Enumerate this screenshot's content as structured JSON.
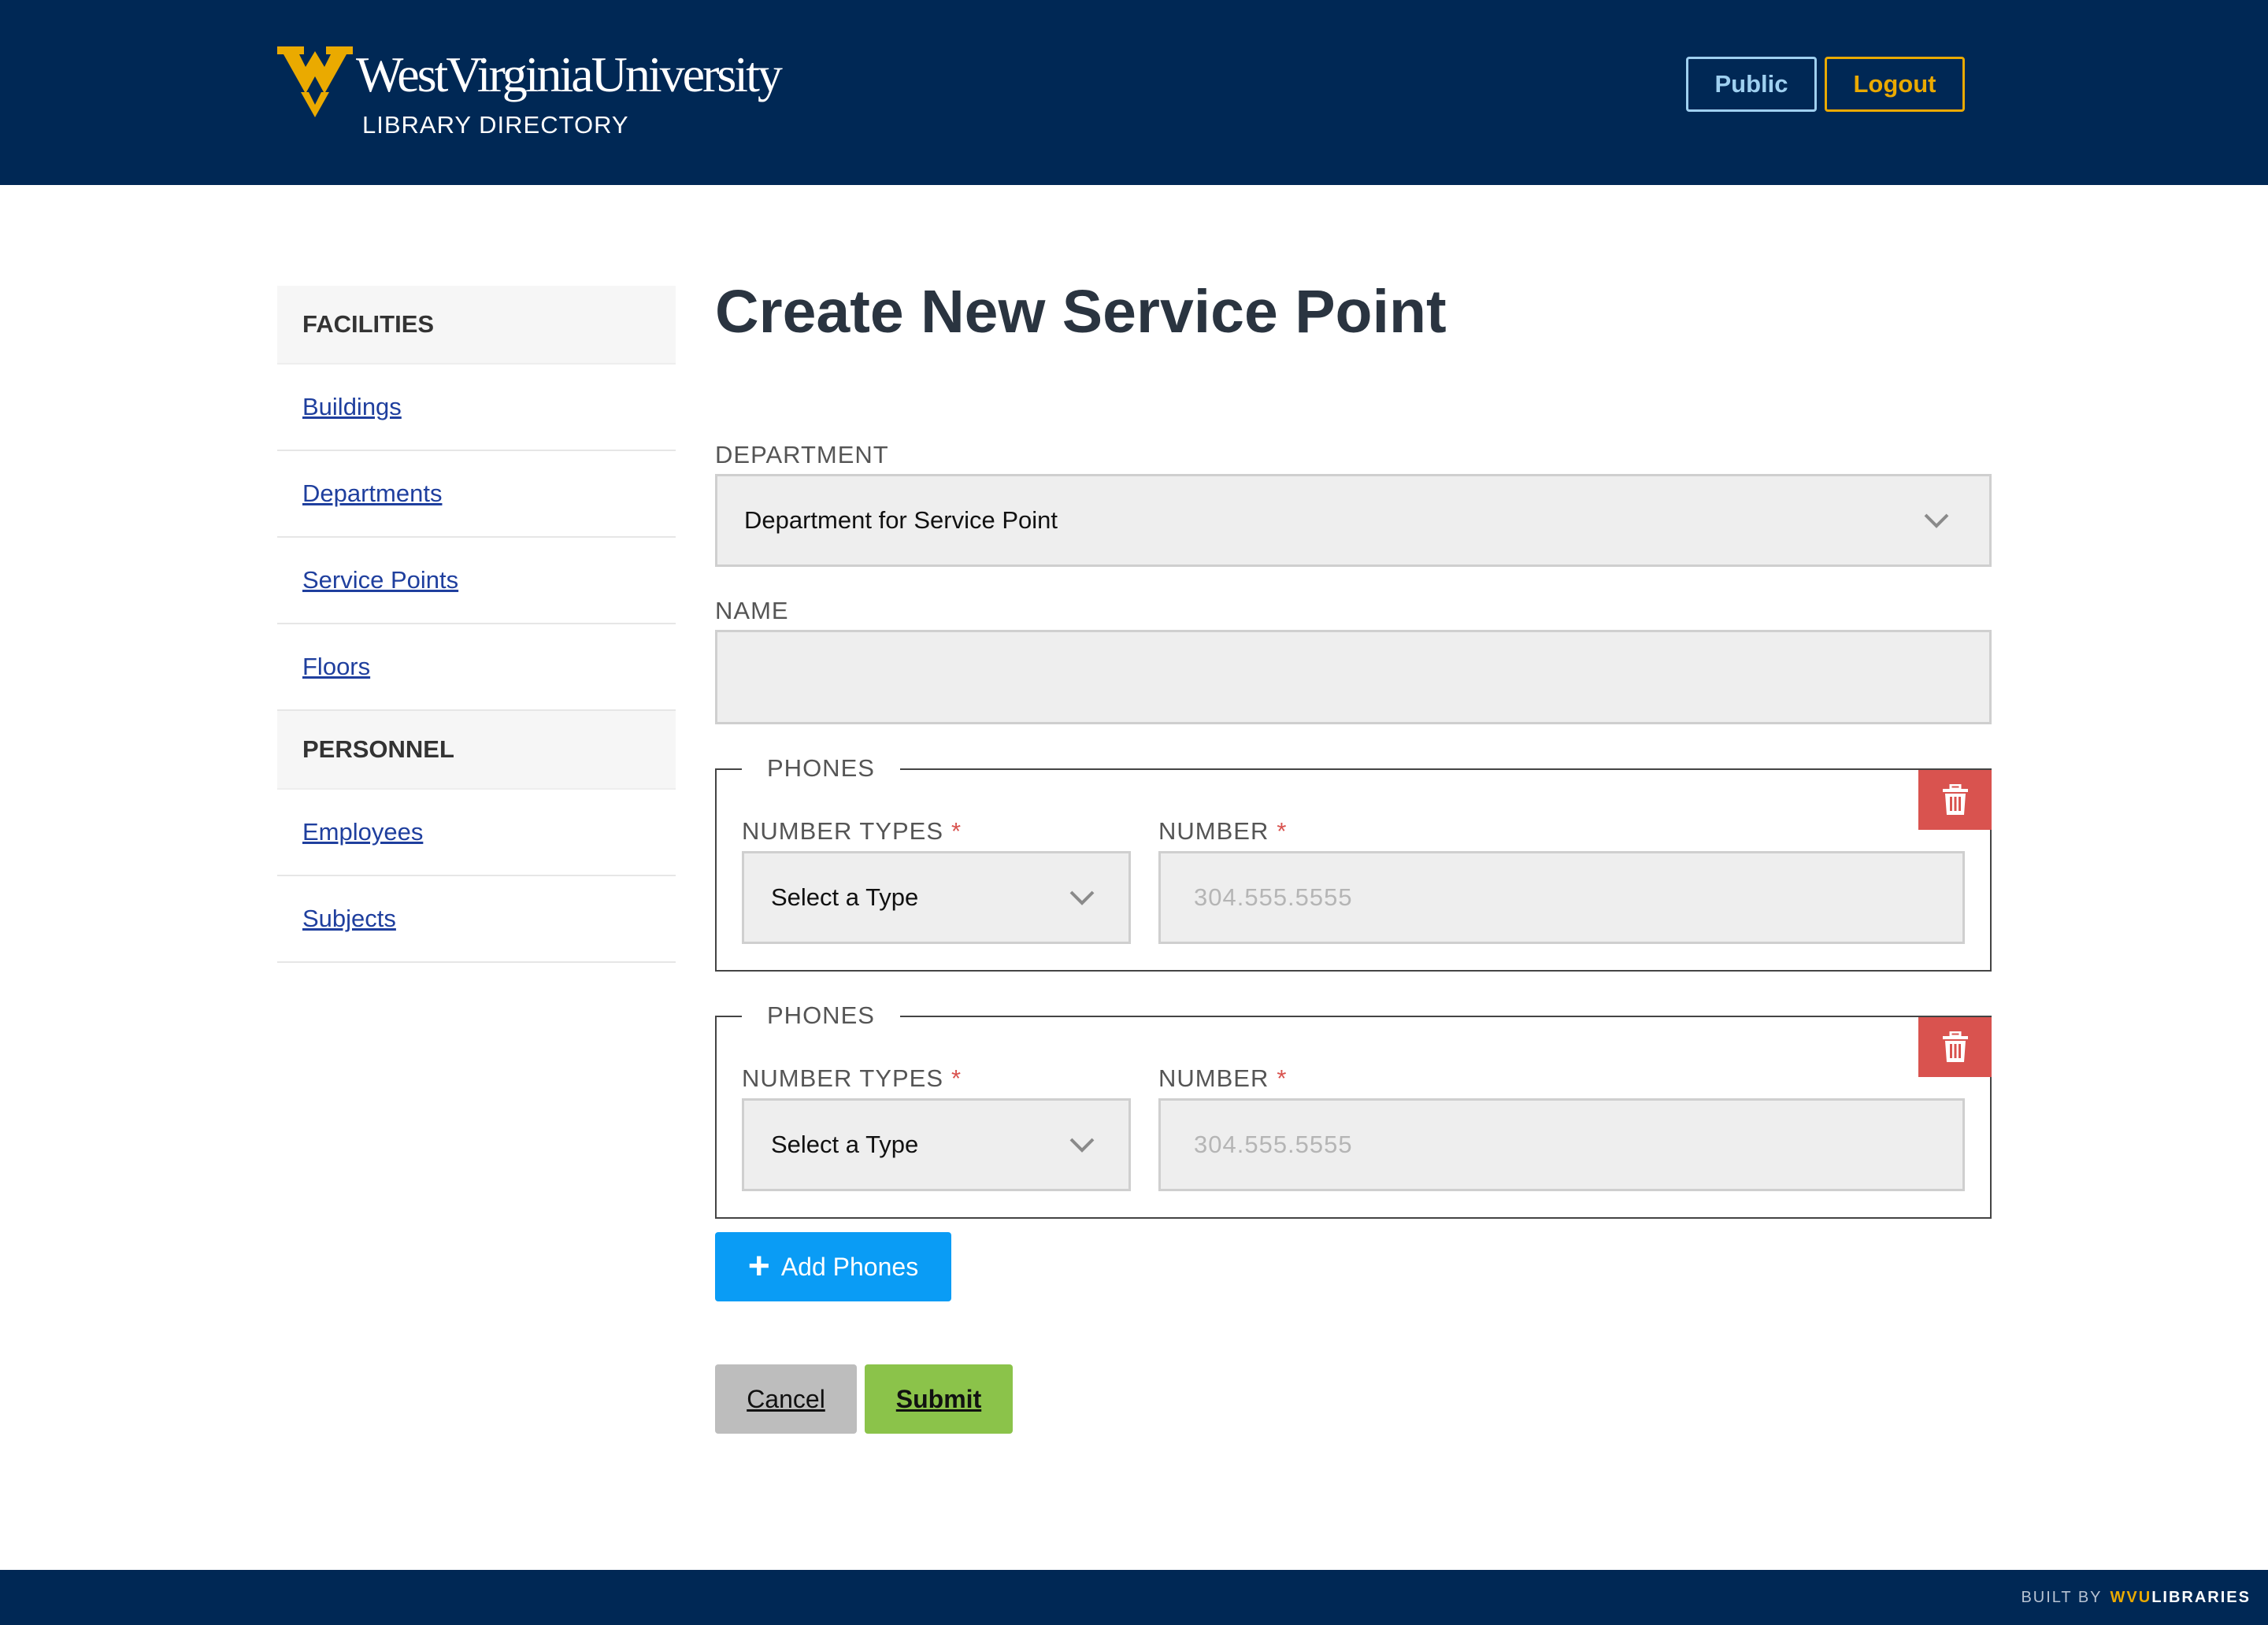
{
  "header": {
    "brand": "WestVirginiaUniversity",
    "subtitle": "LIBRARY DIRECTORY",
    "public_label": "Public",
    "logout_label": "Logout"
  },
  "sidebar": {
    "sections": [
      {
        "heading": "FACILITIES",
        "items": [
          "Buildings",
          "Departments",
          "Service Points",
          "Floors"
        ]
      },
      {
        "heading": "PERSONNEL",
        "items": [
          "Employees",
          "Subjects"
        ]
      }
    ]
  },
  "main": {
    "title": "Create New Service Point",
    "department_label": "DEPARTMENT",
    "department_value": "Department for Service Point",
    "name_label": "NAME",
    "name_value": "",
    "phones": [
      {
        "legend": "PHONES",
        "type_label": "NUMBER TYPES",
        "type_value": "Select a Type",
        "number_label": "NUMBER",
        "number_placeholder": "304.555.5555"
      },
      {
        "legend": "PHONES",
        "type_label": "NUMBER TYPES",
        "type_value": "Select a Type",
        "number_label": "NUMBER",
        "number_placeholder": "304.555.5555"
      }
    ],
    "required_mark": "*",
    "add_phones_label": "Add Phones",
    "add_icon": "+",
    "cancel_label": "Cancel",
    "submit_label": "Submit"
  },
  "footer": {
    "built_by": "BUILT BY",
    "wvu": "WVU",
    "libraries": "LIBRARIES"
  },
  "colors": {
    "navy": "#002855",
    "gold": "#eaaa00",
    "danger": "#d9534f",
    "primary": "#0a9cf5",
    "success": "#8bc34a"
  },
  "icons": [
    "wv-logo-icon",
    "chevron-down-icon",
    "trash-icon",
    "plus-icon"
  ]
}
